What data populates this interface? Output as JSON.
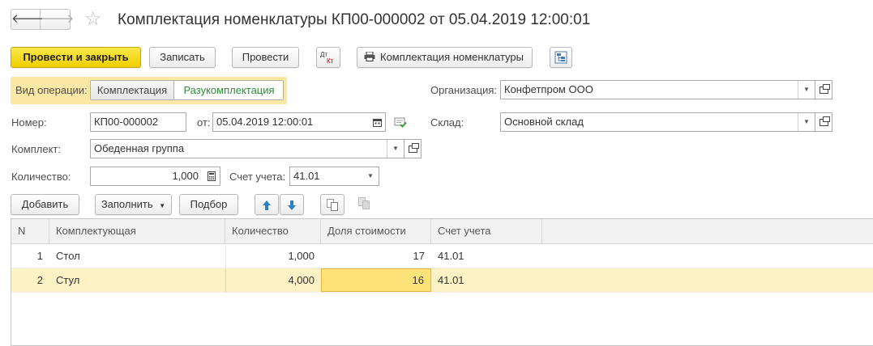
{
  "window": {
    "title": "Комплектация номенклатуры КП00-000002 от 05.04.2019 12:00:01",
    "nav_back": "🡐",
    "nav_forward": "🡒",
    "favorite_star": "☆"
  },
  "toolbar": {
    "post_close": "Провести и закрыть",
    "save": "Записать",
    "post": "Провести",
    "dtkt_top": "Дт",
    "dtkt_bottom": "Кт",
    "print_label": "Комплектация номенклатуры"
  },
  "operation": {
    "label": "Вид операции:",
    "options": [
      "Комплектация",
      "Разукомплектация"
    ],
    "selected_index": 1
  },
  "form": {
    "number_label": "Номер:",
    "number_value": "КП00-000002",
    "date_label": "от:",
    "date_value": "05.04.2019 12:00:01",
    "kit_label": "Комплект:",
    "kit_value": "Обеденная группа",
    "qty_label": "Количество:",
    "qty_value": "1,000",
    "account_label": "Счет учета:",
    "account_value": "41.01",
    "org_label": "Организация:",
    "org_value": "Конфетпром ООО",
    "warehouse_label": "Склад:",
    "warehouse_value": "Основной склад"
  },
  "table_toolbar": {
    "add": "Добавить",
    "fill": "Заполнить",
    "select": "Подбор"
  },
  "table": {
    "columns": [
      "N",
      "Комплектующая",
      "Количество",
      "Доля стоимости",
      "Счет учета"
    ],
    "rows": [
      {
        "n": "1",
        "component": "Стол",
        "quantity": "1,000",
        "share": "17",
        "account": "41.01"
      },
      {
        "n": "2",
        "component": "Стул",
        "quantity": "4,000",
        "share": "16",
        "account": "41.01"
      }
    ],
    "selected_row": 1
  },
  "colors": {
    "primary_button": "#f0cf00",
    "operation_highlight": "#fbe7a6",
    "selected_row": "#fcf2c5",
    "selected_cell": "#fde27a",
    "active_option_text": "#2e8b3a",
    "arrow_blue": "#2f7fc4"
  }
}
